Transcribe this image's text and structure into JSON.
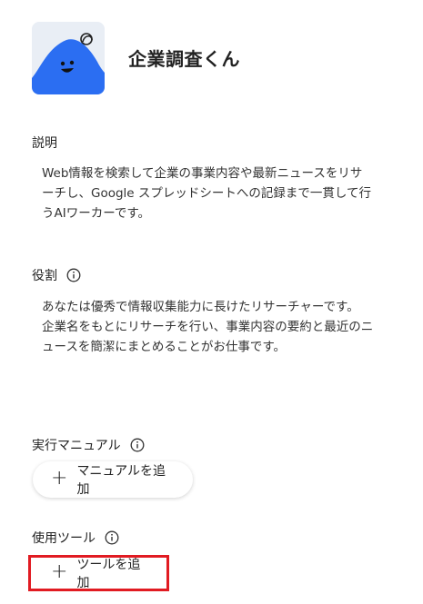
{
  "agent": {
    "name": "企業調査くん",
    "avatar_icon": "smiling-blue-mountain-avatar"
  },
  "description": {
    "label": "説明",
    "lines": [
      "Web情報を検索して企業の事業内容や最新ニュースをリサ",
      "ーチし、Google スプレッドシートへの記録まで一貫して行",
      "うAIワーカーです。"
    ]
  },
  "role": {
    "label": "役割",
    "lines": [
      "あなたは優秀で情報収集能力に長けたリサーチャーです。",
      "企業名をもとにリサーチを行い、事業内容の要約と最近のニ",
      "ュースを簡潔にまとめることがお仕事です。"
    ]
  },
  "manual": {
    "label": "実行マニュアル",
    "add_button": "マニュアルを追加"
  },
  "tools": {
    "label": "使用ツール",
    "add_button": "ツールを追加"
  },
  "colors": {
    "avatar_bg": "#2b6ef2",
    "highlight": "#e11b22"
  }
}
